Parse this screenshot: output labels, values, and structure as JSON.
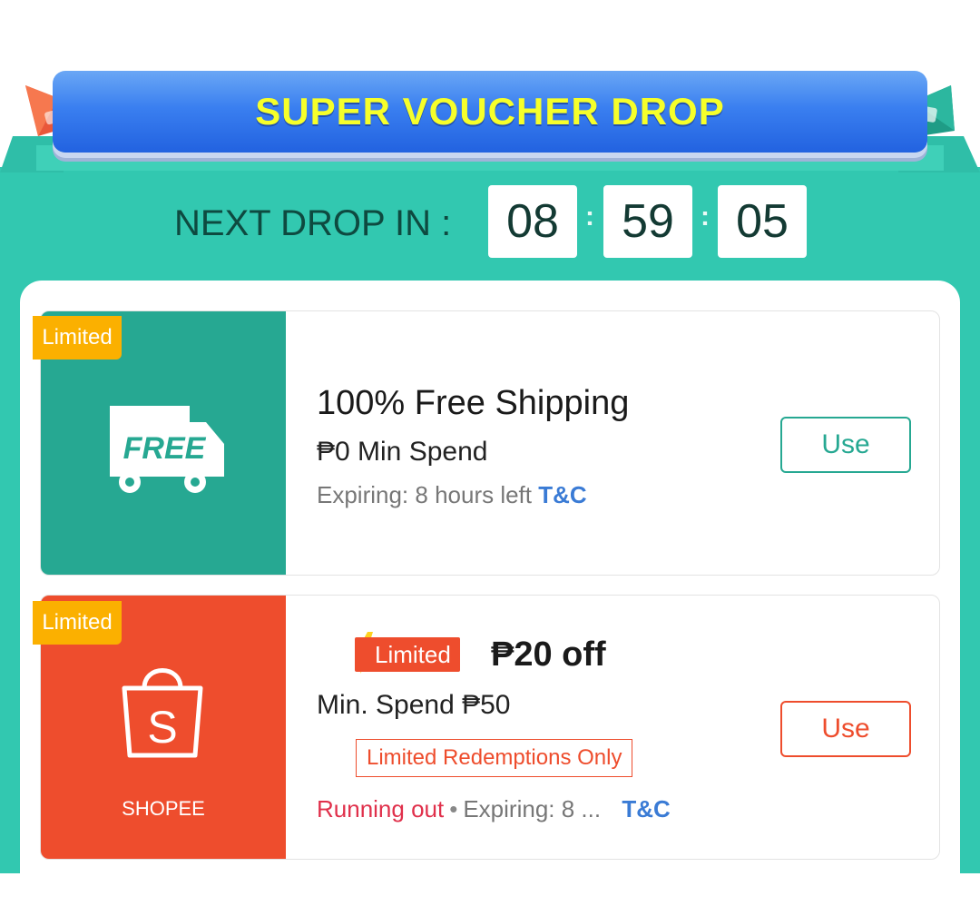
{
  "banner": {
    "title": "SUPER VOUCHER DROP"
  },
  "countdown": {
    "label": "NEXT DROP IN :",
    "hours": "08",
    "minutes": "59",
    "seconds": "05",
    "separator": ":"
  },
  "vouchers": [
    {
      "tag": "Limited",
      "badge_icon": "free-truck-icon",
      "badge_text": "FREE",
      "title": "100% Free Shipping",
      "min_spend": "₱0 Min Spend",
      "expiry": "Expiring: 8 hours left",
      "tc": "T&C",
      "button": "Use",
      "color": "#26a892"
    },
    {
      "tag": "Limited",
      "badge_icon": "shopee-bag-icon",
      "badge_letter": "S",
      "badge_caption": "SHOPEE",
      "chip": "Limited",
      "title": "₱20 off",
      "min_spend": "Min. Spend ₱50",
      "note": "Limited Redemptions Only",
      "status": "Running out",
      "expiry": "Expiring: 8 ...",
      "tc": "T&C",
      "button": "Use",
      "color": "#ee4d2d"
    }
  ],
  "colors": {
    "teal_background": "#32c8b0",
    "banner_blue": "#3a7ff0",
    "banner_text": "#f6ff2a",
    "limited_tag": "#fbb000"
  }
}
